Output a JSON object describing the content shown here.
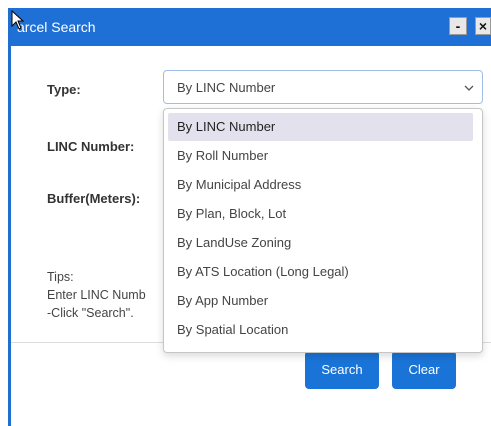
{
  "window": {
    "title": "arcel Search",
    "minimize_label": "-",
    "close_label": "×"
  },
  "form": {
    "type_label": "Type:",
    "linc_label": "LINC Number:",
    "buffer_label": "Buffer(Meters):",
    "type_select_value": "By LINC Number"
  },
  "dropdown": {
    "options": [
      "By LINC Number",
      "By Roll Number",
      "By Municipal Address",
      "By Plan, Block, Lot",
      "By LandUse Zoning",
      "By ATS Location (Long Legal)",
      "By App Number",
      "By Spatial Location"
    ],
    "highlighted": "By LINC Number"
  },
  "tips": {
    "line1": "Tips:",
    "line2": "Enter LINC Numb",
    "line3": "-Click \"Search\"."
  },
  "buttons": {
    "search_label": "Search",
    "clear_label": "Clear"
  },
  "colors": {
    "titlebar": "#1e6fd6",
    "button": "#1a74d8",
    "highlight": "#e4e1ee"
  }
}
